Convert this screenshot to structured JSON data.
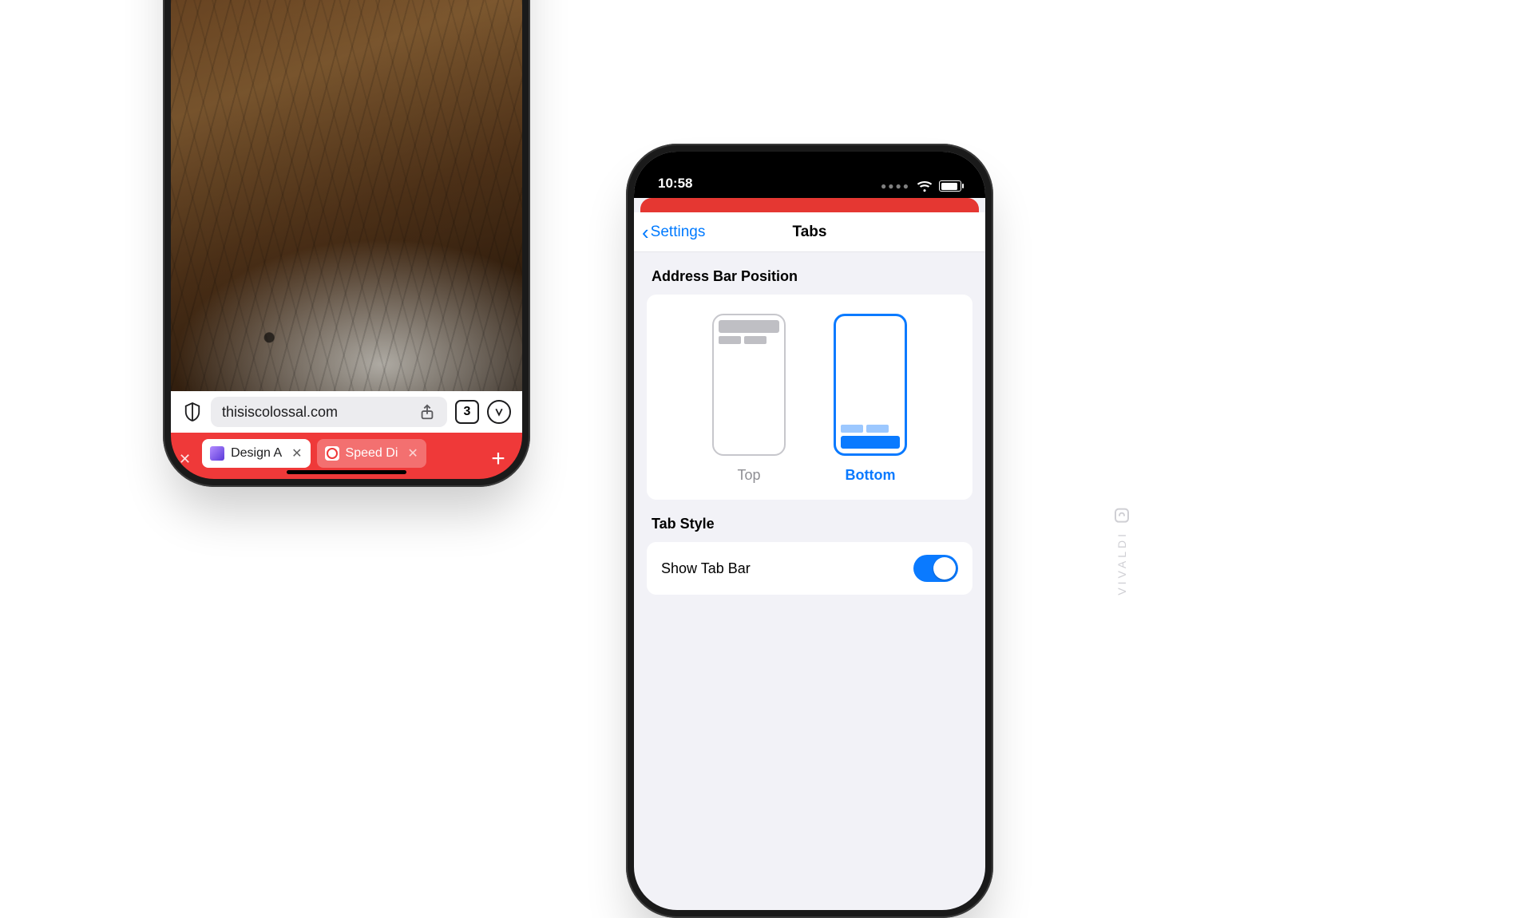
{
  "left": {
    "address_url": "thisiscolossal.com",
    "tab_count": "3",
    "tabs": [
      {
        "label": "Design A",
        "active": true
      },
      {
        "label": "Speed Di",
        "active": false
      }
    ],
    "icons": {
      "shield": "shield-icon",
      "share": "share-icon",
      "vivaldi": "vivaldi-icon",
      "new_tab": "plus-icon"
    }
  },
  "right": {
    "status": {
      "time": "10:58"
    },
    "nav": {
      "back_label": "Settings",
      "title": "Tabs"
    },
    "sections": {
      "address_bar_position": {
        "label": "Address Bar Position",
        "options": {
          "top": "Top",
          "bottom": "Bottom"
        },
        "selected": "bottom"
      },
      "tab_style": {
        "label": "Tab Style",
        "show_tab_bar_label": "Show Tab Bar",
        "show_tab_bar_value": true
      }
    }
  },
  "watermark": "VIVALDI"
}
